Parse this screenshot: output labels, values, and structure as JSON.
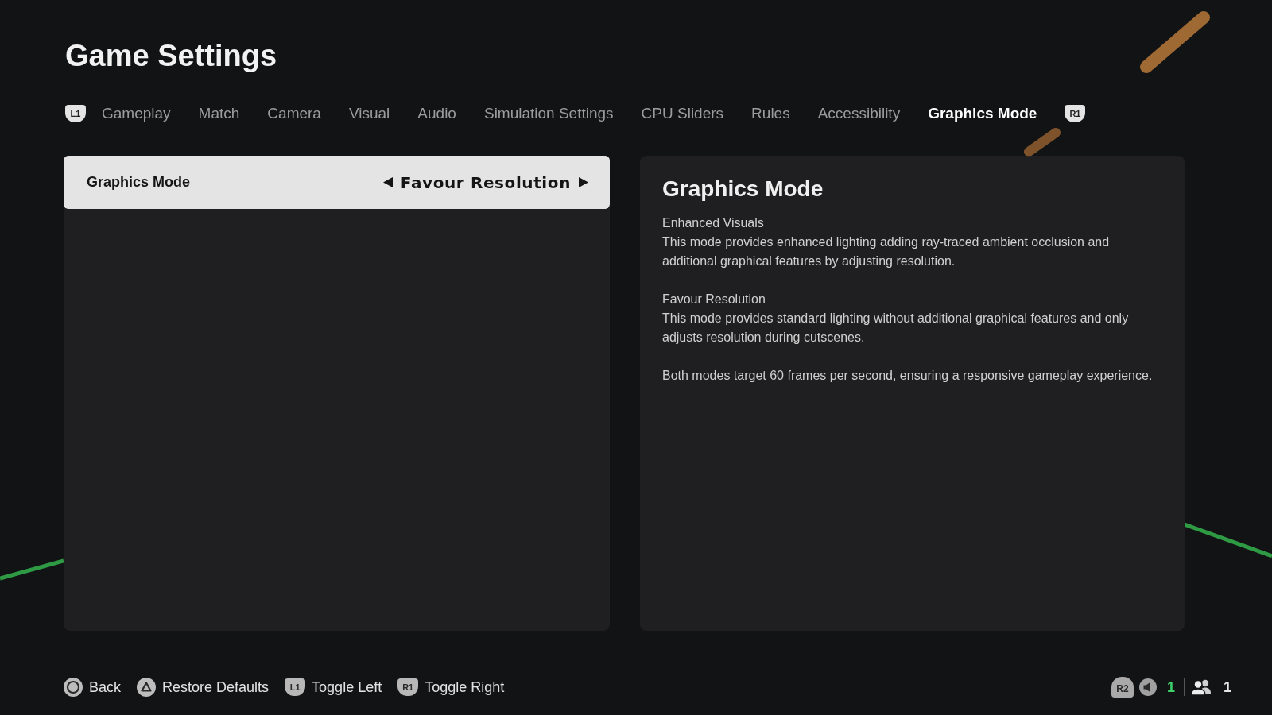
{
  "title": "Game Settings",
  "tabs": {
    "prev_key": "L1",
    "next_key": "R1",
    "items": [
      {
        "label": "Gameplay",
        "selected": false
      },
      {
        "label": "Match",
        "selected": false
      },
      {
        "label": "Camera",
        "selected": false
      },
      {
        "label": "Visual",
        "selected": false
      },
      {
        "label": "Audio",
        "selected": false
      },
      {
        "label": "Simulation Settings",
        "selected": false
      },
      {
        "label": "CPU Sliders",
        "selected": false
      },
      {
        "label": "Rules",
        "selected": false
      },
      {
        "label": "Accessibility",
        "selected": false
      },
      {
        "label": "Graphics Mode",
        "selected": true
      }
    ]
  },
  "settings": [
    {
      "label": "Graphics Mode",
      "value": "Favour Resolution",
      "selected": true
    }
  ],
  "description": {
    "title": "Graphics Mode",
    "paragraphs": [
      {
        "heading": "Enhanced Visuals",
        "text": "This mode provides enhanced lighting adding ray-traced ambient occlusion and additional graphical features by adjusting resolution."
      },
      {
        "heading": "Favour Resolution",
        "text": "This mode provides standard lighting without additional graphical features and only adjusts resolution during cutscenes."
      },
      {
        "text": "Both modes target 60 frames per second, ensuring a responsive gameplay experience."
      }
    ]
  },
  "footer": {
    "actions": [
      {
        "kind": "circle",
        "label": "Back"
      },
      {
        "kind": "triangle",
        "label": "Restore Defaults"
      },
      {
        "kind": "key",
        "key": "L1",
        "label": "Toggle Left"
      },
      {
        "kind": "key",
        "key": "R1",
        "label": "Toggle Right"
      }
    ],
    "status": {
      "key": "R2",
      "voice_count": "1",
      "players_count": "1"
    }
  }
}
